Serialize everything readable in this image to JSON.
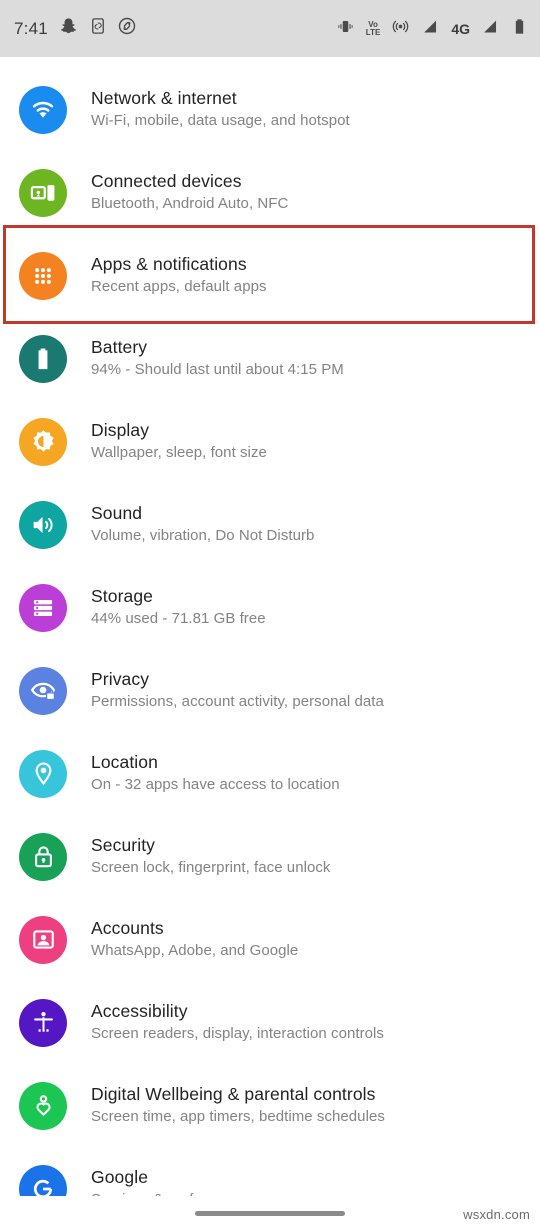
{
  "statusbar": {
    "time": "7:41",
    "left_icons": [
      "snapchat-icon",
      "screen-cast-icon",
      "shazam-icon"
    ],
    "right_icons": [
      "vibrate-icon",
      "volte-icon",
      "hotspot-icon",
      "signal-sim1-icon",
      "network-4g-icon",
      "signal-sim2-icon",
      "battery-icon"
    ],
    "volte_top": "Vo",
    "volte_bottom": "LTE",
    "network_type": "4G",
    "background": "#dcdcdc"
  },
  "highlight": {
    "color": "#c0392b",
    "target": "Apps & notifications"
  },
  "settings": {
    "items": [
      {
        "title": "Network & internet",
        "subtitle": "Wi-Fi, mobile, data usage, and hotspot",
        "icon": "wifi-icon",
        "color": "#1a8cf0",
        "name": "network-and-internet"
      },
      {
        "title": "Connected devices",
        "subtitle": "Bluetooth, Android Auto, NFC",
        "icon": "connected-devices-icon",
        "color": "#6eb522",
        "name": "connected-devices"
      },
      {
        "title": "Apps & notifications",
        "subtitle": "Recent apps, default apps",
        "icon": "apps-grid-icon",
        "color": "#f58220",
        "name": "apps-and-notifications",
        "highlighted": true
      },
      {
        "title": "Battery",
        "subtitle": "94% - Should last until about 4:15 PM",
        "icon": "battery-icon",
        "color": "#1a7a72",
        "name": "battery"
      },
      {
        "title": "Display",
        "subtitle": "Wallpaper, sleep, font size",
        "icon": "brightness-icon",
        "color": "#f5a623",
        "name": "display"
      },
      {
        "title": "Sound",
        "subtitle": "Volume, vibration, Do Not Disturb",
        "icon": "volume-icon",
        "color": "#0fa5a0",
        "name": "sound"
      },
      {
        "title": "Storage",
        "subtitle": "44% used - 71.81 GB free",
        "icon": "storage-icon",
        "color": "#bb3fd6",
        "name": "storage"
      },
      {
        "title": "Privacy",
        "subtitle": "Permissions, account activity, personal data",
        "icon": "privacy-eye-icon",
        "color": "#5b82e0",
        "name": "privacy"
      },
      {
        "title": "Location",
        "subtitle": "On - 32 apps have access to location",
        "icon": "location-pin-icon",
        "color": "#36c5da",
        "name": "location"
      },
      {
        "title": "Security",
        "subtitle": "Screen lock, fingerprint, face unlock",
        "icon": "lock-icon",
        "color": "#18a257",
        "name": "security"
      },
      {
        "title": "Accounts",
        "subtitle": "WhatsApp, Adobe, and Google",
        "icon": "account-person-icon",
        "color": "#ee4080",
        "name": "accounts"
      },
      {
        "title": "Accessibility",
        "subtitle": "Screen readers, display, interaction controls",
        "icon": "accessibility-icon",
        "color": "#5517c4",
        "name": "accessibility"
      },
      {
        "title": "Digital Wellbeing & parental controls",
        "subtitle": "Screen time, app timers, bedtime schedules",
        "icon": "wellbeing-heart-icon",
        "color": "#1bc653",
        "name": "digital-wellbeing"
      },
      {
        "title": "Google",
        "subtitle": "Services & preferences",
        "icon": "google-g-icon",
        "color": "#1a73e8",
        "name": "google"
      }
    ]
  },
  "navbar": {
    "gesture_pill": "home-gesture-pill"
  },
  "watermark": {
    "text": "wsxdn.com"
  }
}
